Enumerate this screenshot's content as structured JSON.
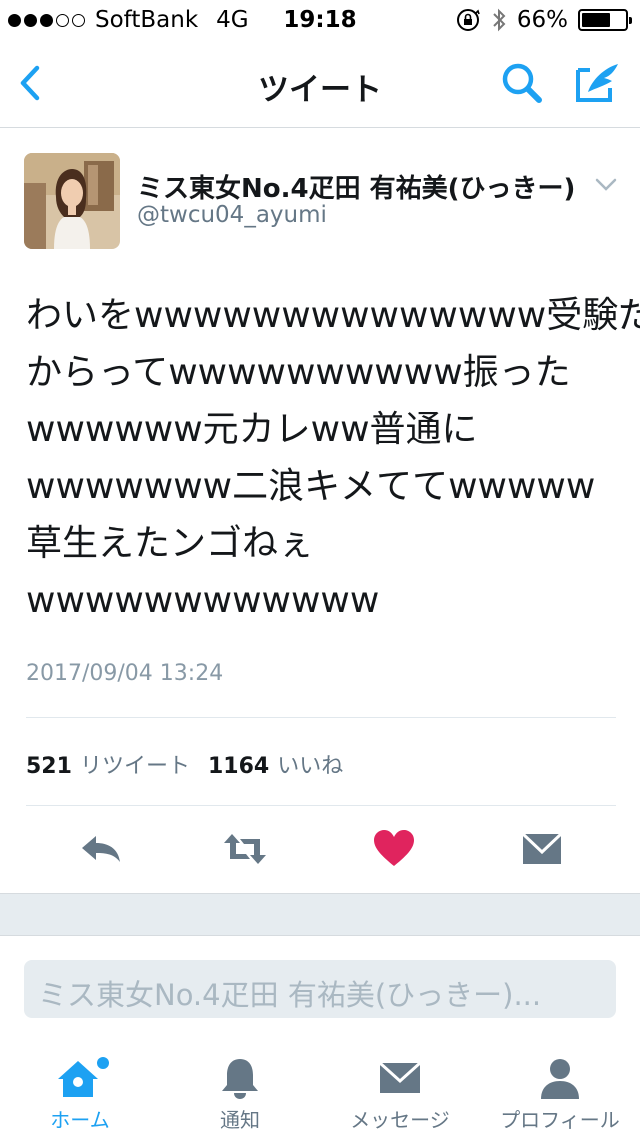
{
  "status_bar": {
    "carrier": "SoftBank",
    "network": "4G",
    "time": "19:18",
    "battery": "66%",
    "battery_level": 0.66
  },
  "nav": {
    "title": "ツイート",
    "back_icon": "chevron-left-icon",
    "search_icon": "search-icon",
    "compose_icon": "compose-icon"
  },
  "tweet": {
    "display_name": "ミス東女No.4疋田 有祐美(ひっきー)",
    "screen_name": "@twcu04_ayumi",
    "text_lines": [
      "わいをwwwwwwwwwwwwww受験だ",
      "からってwwwwwwwwww振った",
      "wwwwww元カレww普通に",
      "wwwwwww二浪キメててwwwww",
      "草生えたンゴねぇ",
      "wwwwwwwwwwww"
    ],
    "timestamp": "2017/09/04 13:24",
    "retweet_count": "521",
    "retweet_label": "リツイート",
    "like_count": "1164",
    "like_label": "いいね"
  },
  "reply": {
    "placeholder": "ミス東女No.4疋田 有祐美(ひっきー)..."
  },
  "tabs": [
    {
      "label": "ホーム",
      "icon": "home-icon",
      "active": true
    },
    {
      "label": "通知",
      "icon": "bell-icon",
      "active": false
    },
    {
      "label": "メッセージ",
      "icon": "envelope-icon",
      "active": false
    },
    {
      "label": "プロフィール",
      "icon": "person-icon",
      "active": false
    }
  ],
  "colors": {
    "accent": "#1da1f2",
    "like": "#e0245e",
    "icon_gray": "#657786",
    "secondary_text": "#8899a6"
  }
}
